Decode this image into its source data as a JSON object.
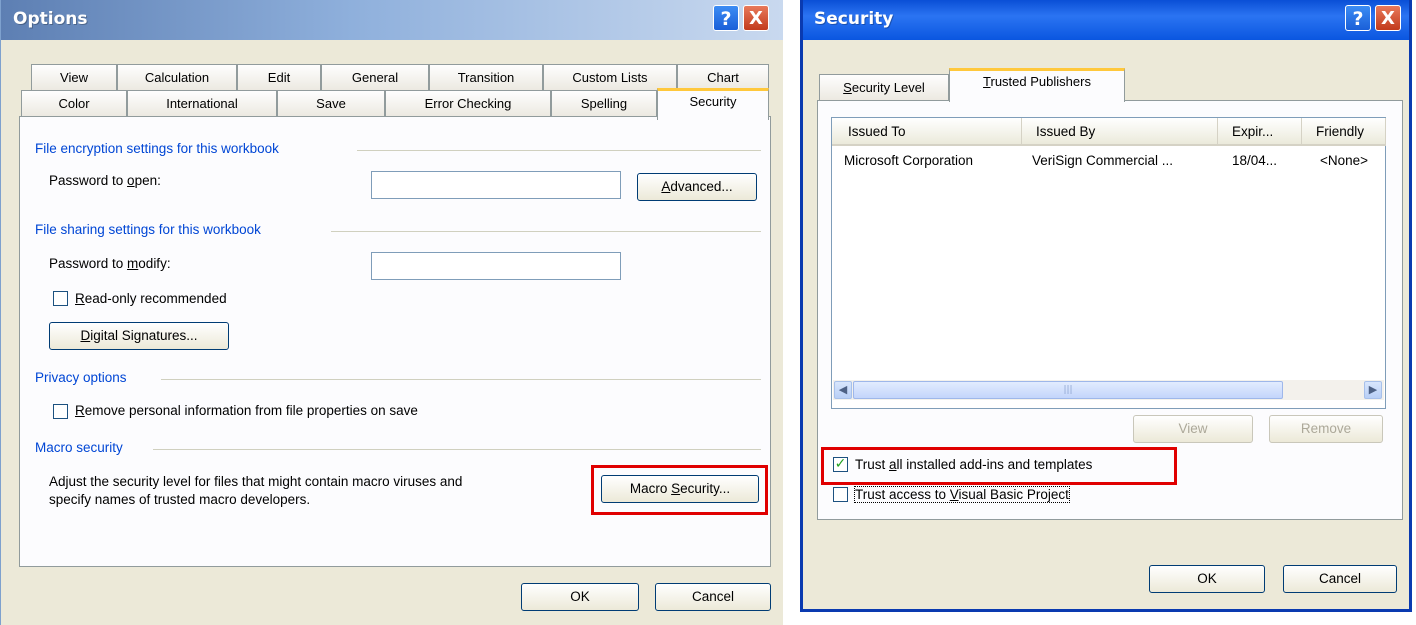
{
  "options_dialog": {
    "title": "Options",
    "help_button": "?",
    "close_button": "X",
    "tabs_row1": [
      "View",
      "Calculation",
      "Edit",
      "General",
      "Transition",
      "Custom Lists",
      "Chart"
    ],
    "tabs_row2": [
      "Color",
      "International",
      "Save",
      "Error Checking",
      "Spelling",
      "Security"
    ],
    "active_tab": "Security",
    "file_encryption": {
      "heading": "File encryption settings for this workbook",
      "password_open_label": "Password to open:",
      "password_open_value": "",
      "advanced_button": "Advanced..."
    },
    "file_sharing": {
      "heading": "File sharing settings for this workbook",
      "password_modify_label": "Password to modify:",
      "password_modify_value": "",
      "readonly_label": "Read-only recommended",
      "readonly_checked": false,
      "digital_signatures_button": "Digital Signatures..."
    },
    "privacy": {
      "heading": "Privacy options",
      "remove_info_label": "Remove personal information from file properties on save",
      "remove_info_checked": false
    },
    "macro": {
      "heading": "Macro security",
      "description_line1": "Adjust the security level for files that might contain macro viruses and",
      "description_line2": "specify names of trusted macro developers.",
      "macro_security_button": "Macro Security..."
    },
    "ok_button": "OK",
    "cancel_button": "Cancel"
  },
  "security_dialog": {
    "title": "Security",
    "help_button": "?",
    "close_button": "X",
    "tabs": [
      "Security Level",
      "Trusted Publishers"
    ],
    "active_tab": "Trusted Publishers",
    "columns": [
      "Issued To",
      "Issued By",
      "Expir...",
      "Friendly"
    ],
    "rows": [
      [
        "Microsoft Corporation",
        "VeriSign Commercial ...",
        "18/04...",
        "<None>"
      ]
    ],
    "view_button": "View",
    "remove_button": "Remove",
    "trust_addins_label": "Trust all installed add-ins and templates",
    "trust_addins_checked": true,
    "trust_vba_label": "Trust access to Visual Basic Project",
    "trust_vba_checked": false,
    "ok_button": "OK",
    "cancel_button": "Cancel"
  },
  "colors": {
    "titlebar_start": "#0a246a",
    "titlebar_end": "#3a6ee8",
    "dialog_bg": "#ece9d8",
    "group_heading": "#0046d5",
    "highlight": "#e00000"
  }
}
